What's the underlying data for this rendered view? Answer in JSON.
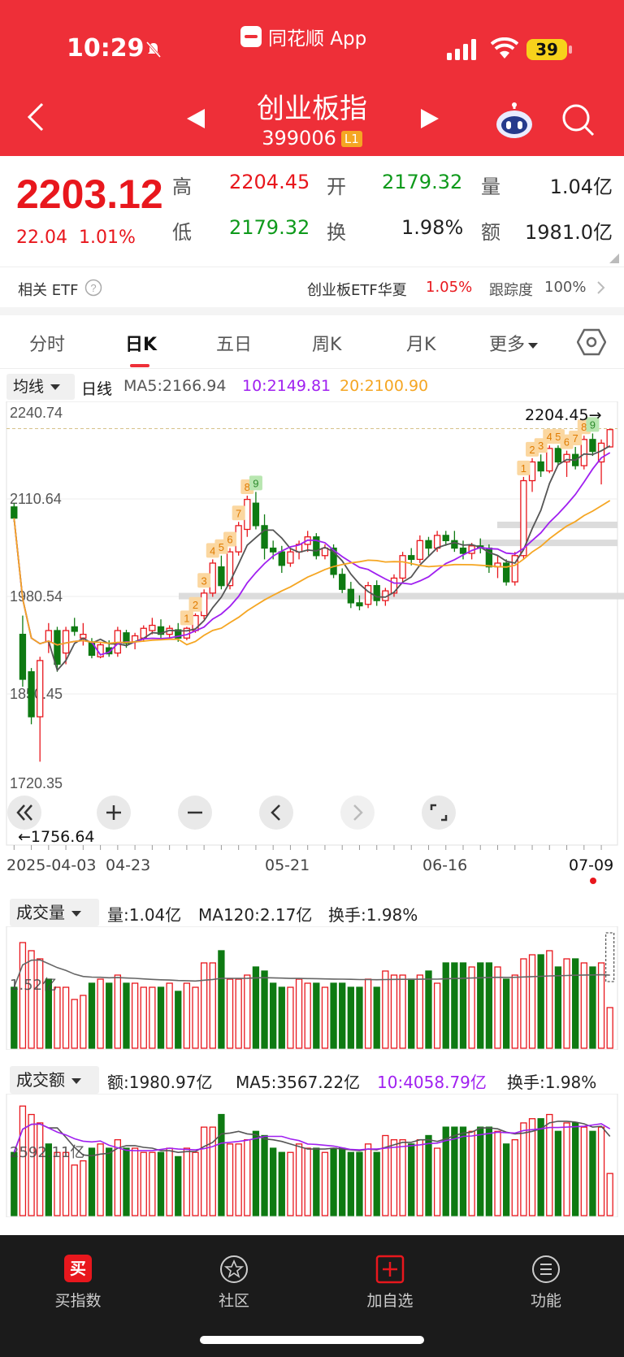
{
  "status": {
    "time": "10:29",
    "battery": "39",
    "app_name": "同花顺 App"
  },
  "header": {
    "title": "创业板指",
    "code": "399006",
    "level": "L1"
  },
  "quote": {
    "price": "2203.12",
    "change": "22.04",
    "change_pct": "1.01%",
    "high_label": "高",
    "high": "2204.45",
    "open_label": "开",
    "open": "2179.32",
    "volume_label": "量",
    "volume": "1.04亿",
    "low_label": "低",
    "low": "2179.32",
    "turnover_label": "换",
    "turnover": "1.98%",
    "amount_label": "额",
    "amount": "1981.0亿"
  },
  "etf": {
    "label": "相关 ETF",
    "name": "创业板ETF华夏",
    "pct": "1.05%",
    "track_label": "跟踪度",
    "track": "100%"
  },
  "tabs": [
    "分时",
    "日K",
    "五日",
    "周K",
    "月K",
    "更多"
  ],
  "ma": {
    "selector": "均线",
    "period": "日线",
    "ma5": "MA5:2166.94",
    "ma10": "10:2149.81",
    "ma20": "20:2100.90"
  },
  "price_axis": [
    "2240.74",
    "2110.64",
    "1980.54",
    "1850.45",
    "1720.35"
  ],
  "annotations": {
    "high": "2204.45→",
    "low": "←1756.64"
  },
  "dates": [
    "2025-04-03",
    "04-23",
    "05-21",
    "06-16",
    "07-09"
  ],
  "volume_panel": {
    "selector": "成交量",
    "vol": "量:1.04亿",
    "ma120": "MA120:2.17亿",
    "turnover": "换手:1.98%",
    "axis": "1.52亿"
  },
  "amount_panel": {
    "selector": "成交额",
    "amt": "额:1980.97亿",
    "ma5": "MA5:3567.22亿",
    "ma10": "10:4058.79亿",
    "turnover": "换手:1.98%",
    "axis": "2592.11亿"
  },
  "nav": [
    "买指数",
    "社区",
    "加自选",
    "功能"
  ],
  "colors": {
    "up": "#e8171d",
    "down": "#0e7a12",
    "ma5": "#555555",
    "ma10": "#a020f0",
    "ma20": "#f5a623"
  },
  "chart_data": {
    "type": "candlestick",
    "categories": [
      "2025-04-03",
      "",
      "",
      "",
      "",
      "",
      "",
      "",
      "",
      "",
      "",
      "",
      "",
      "04-23",
      "",
      "",
      "",
      "",
      "",
      "",
      "",
      "",
      "",
      "",
      "",
      "",
      "",
      "",
      "",
      "",
      "",
      "",
      "05-21",
      "",
      "",
      "",
      "",
      "",
      "",
      "",
      "",
      "",
      "",
      "",
      "",
      "",
      "",
      "",
      "",
      "06-16",
      "",
      "",
      "",
      "",
      "",
      "",
      "",
      "",
      "",
      "",
      "",
      "",
      "",
      "",
      "",
      "",
      "07-09"
    ],
    "series": [
      {
        "name": "K",
        "ohlc": [
          [
            2100,
            2105,
            2080,
            2085
          ],
          [
            1930,
            1955,
            1860,
            1870
          ],
          [
            1880,
            1885,
            1810,
            1820
          ],
          [
            1820,
            1900,
            1760,
            1895
          ],
          [
            1920,
            1945,
            1905,
            1935
          ],
          [
            1935,
            1940,
            1880,
            1890
          ],
          [
            1905,
            1940,
            1890,
            1935
          ],
          [
            1940,
            1952,
            1928,
            1934
          ],
          [
            1925,
            1945,
            1915,
            1930
          ],
          [
            1920,
            1925,
            1898,
            1902
          ],
          [
            1900,
            1920,
            1898,
            1916
          ],
          [
            1912,
            1922,
            1900,
            1904
          ],
          [
            1905,
            1940,
            1900,
            1935
          ],
          [
            1932,
            1936,
            1912,
            1918
          ],
          [
            1920,
            1932,
            1910,
            1928
          ],
          [
            1925,
            1942,
            1920,
            1938
          ],
          [
            1935,
            1952,
            1930,
            1942
          ],
          [
            1940,
            1950,
            1925,
            1930
          ],
          [
            1930,
            1942,
            1925,
            1938
          ],
          [
            1936,
            1945,
            1920,
            1925
          ],
          [
            1925,
            1940,
            1922,
            1938
          ],
          [
            1935,
            1958,
            1932,
            1955
          ],
          [
            1955,
            1990,
            1950,
            1985
          ],
          [
            1985,
            2030,
            1980,
            2025
          ],
          [
            2020,
            2035,
            1990,
            1995
          ],
          [
            1995,
            2045,
            1990,
            2040
          ],
          [
            2040,
            2080,
            2035,
            2075
          ],
          [
            2070,
            2115,
            2060,
            2110
          ],
          [
            2105,
            2120,
            2070,
            2075
          ],
          [
            2075,
            2090,
            2030,
            2045
          ],
          [
            2045,
            2055,
            2030,
            2040
          ],
          [
            2040,
            2048,
            2012,
            2022
          ],
          [
            2025,
            2045,
            2020,
            2040
          ],
          [
            2040,
            2055,
            2030,
            2050
          ],
          [
            2050,
            2068,
            2040,
            2060
          ],
          [
            2060,
            2065,
            2030,
            2035
          ],
          [
            2035,
            2050,
            2030,
            2045
          ],
          [
            2045,
            2050,
            2005,
            2010
          ],
          [
            2010,
            2018,
            1985,
            1990
          ],
          [
            1990,
            2000,
            1965,
            1972
          ],
          [
            1972,
            1982,
            1962,
            1968
          ],
          [
            1970,
            2000,
            1965,
            1995
          ],
          [
            1995,
            2002,
            1968,
            1975
          ],
          [
            1975,
            1992,
            1968,
            1988
          ],
          [
            1985,
            2010,
            1980,
            2005
          ],
          [
            2005,
            2040,
            2000,
            2035
          ],
          [
            2035,
            2045,
            2022,
            2030
          ],
          [
            2030,
            2062,
            2025,
            2055
          ],
          [
            2055,
            2060,
            2035,
            2045
          ],
          [
            2045,
            2068,
            2040,
            2062
          ],
          [
            2062,
            2068,
            2048,
            2055
          ],
          [
            2055,
            2068,
            2040,
            2045
          ],
          [
            2045,
            2055,
            2030,
            2038
          ],
          [
            2038,
            2052,
            2030,
            2048
          ],
          [
            2048,
            2058,
            2038,
            2045
          ],
          [
            2045,
            2050,
            2012,
            2020
          ],
          [
            2020,
            2035,
            2005,
            2025
          ],
          [
            2025,
            2030,
            1995,
            2000
          ],
          [
            2000,
            2040,
            1995,
            2035
          ],
          [
            2035,
            2140,
            2030,
            2135
          ],
          [
            2135,
            2165,
            2120,
            2160
          ],
          [
            2160,
            2170,
            2140,
            2148
          ],
          [
            2148,
            2182,
            2145,
            2178
          ],
          [
            2178,
            2182,
            2155,
            2160
          ],
          [
            2160,
            2175,
            2140,
            2170
          ],
          [
            2170,
            2180,
            2150,
            2155
          ],
          [
            2155,
            2195,
            2150,
            2190
          ],
          [
            2190,
            2198,
            2168,
            2174
          ],
          [
            2160,
            2190,
            2130,
            2185
          ],
          [
            2180,
            2204.45,
            2179.32,
            2203.12
          ]
        ]
      }
    ],
    "ylim": [
      1720.35,
      2240.74
    ]
  },
  "volume_data": [
    1.5,
    2.6,
    2.4,
    2.2,
    1.7,
    1.5,
    1.5,
    1.2,
    1.3,
    1.6,
    1.7,
    1.6,
    1.8,
    1.6,
    1.6,
    1.5,
    1.5,
    1.5,
    1.6,
    1.4,
    1.6,
    1.5,
    2.1,
    2.1,
    2.4,
    1.7,
    1.7,
    1.8,
    2.0,
    1.9,
    1.6,
    1.5,
    1.5,
    1.7,
    1.6,
    1.6,
    1.5,
    1.6,
    1.6,
    1.5,
    1.5,
    1.7,
    1.5,
    1.9,
    1.8,
    1.8,
    1.7,
    1.8,
    1.9,
    1.6,
    2.1,
    2.1,
    2.1,
    2.0,
    2.1,
    2.1,
    2.0,
    1.7,
    1.8,
    2.2,
    2.3,
    2.3,
    2.4,
    2.0,
    2.2,
    2.2,
    2.1,
    2.0,
    2.1,
    1.0
  ],
  "volume_up": [
    0,
    1,
    1,
    1,
    0,
    1,
    1,
    1,
    1,
    0,
    1,
    0,
    1,
    0,
    1,
    1,
    1,
    0,
    1,
    0,
    1,
    1,
    1,
    1,
    0,
    1,
    1,
    1,
    0,
    0,
    0,
    0,
    1,
    1,
    1,
    0,
    1,
    0,
    0,
    0,
    0,
    1,
    0,
    1,
    1,
    1,
    0,
    1,
    0,
    1,
    0,
    0,
    0,
    1,
    0,
    0,
    1,
    0,
    1,
    1,
    1,
    0,
    1,
    0,
    1,
    0,
    1,
    0,
    1,
    1
  ]
}
